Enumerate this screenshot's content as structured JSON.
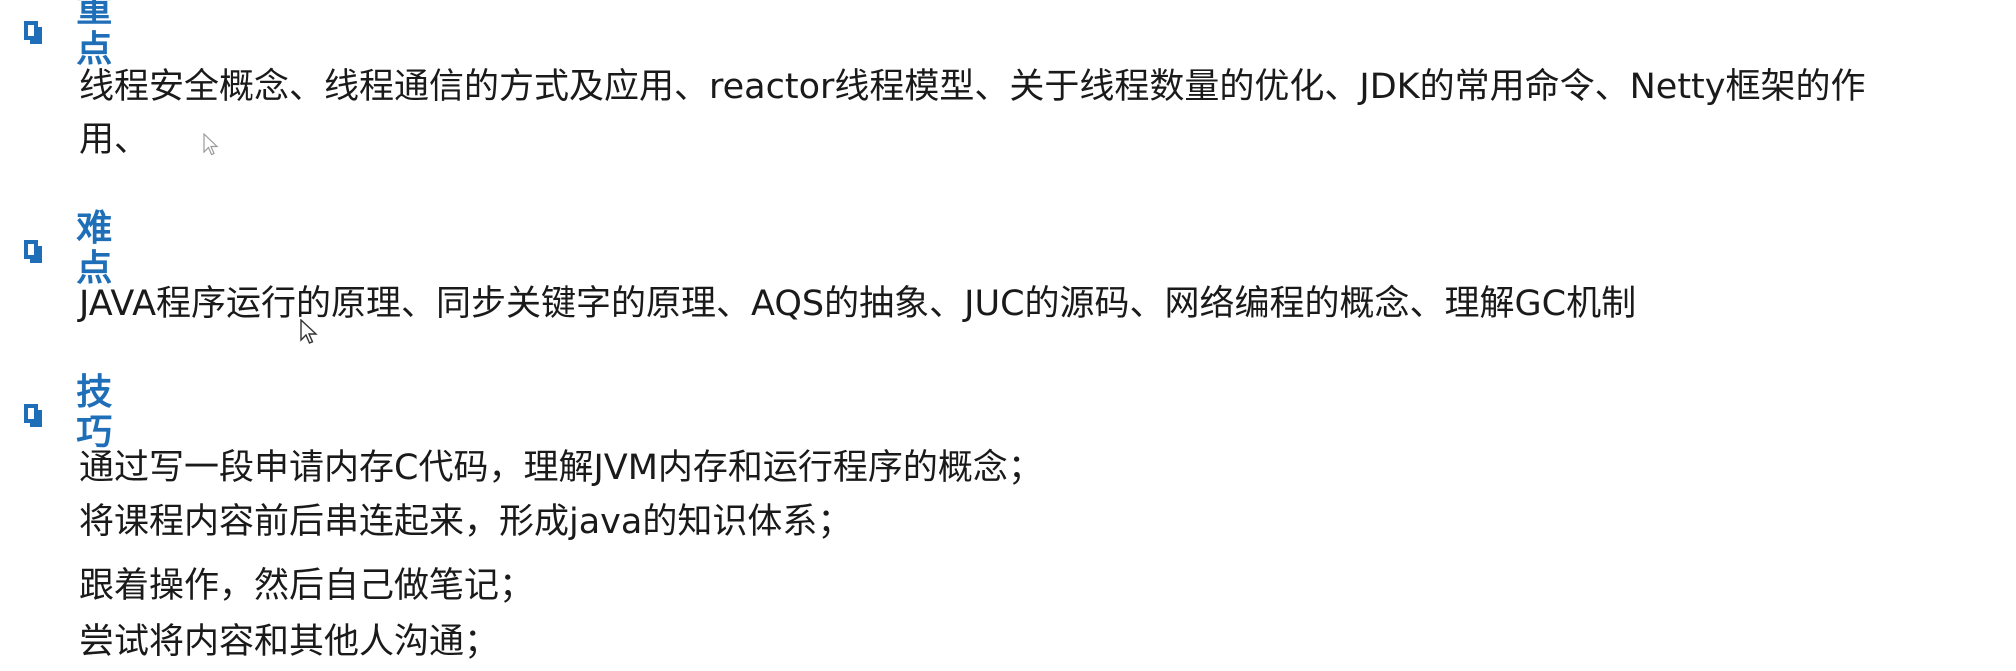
{
  "sections": [
    {
      "heading": "重点",
      "lines": [
        "线程安全概念、线程通信的方式及应用、reactor线程模型、关于线程数量的优化、JDK的常用命令、Netty框架的作",
        "用、"
      ]
    },
    {
      "heading": "难点",
      "lines": [
        "JAVA程序运行的原理、同步关键字的原理、AQS的抽象、JUC的源码、网络编程的概念、理解GC机制"
      ]
    },
    {
      "heading": "技巧",
      "lines": [
        "通过写一段申请内存C代码，理解JVM内存和运行程序的概念；",
        "将课程内容前后串连起来，形成java的知识体系；",
        "跟着操作，然后自己做笔记；",
        "尝试将内容和其他人沟通；"
      ]
    }
  ],
  "colors": {
    "heading": "#1f6fb8",
    "text": "#1a1a1a",
    "background": "#ffffff"
  },
  "icons": {
    "bullet": "square-bullet-icon",
    "pointer": "mouse-pointer-icon"
  }
}
